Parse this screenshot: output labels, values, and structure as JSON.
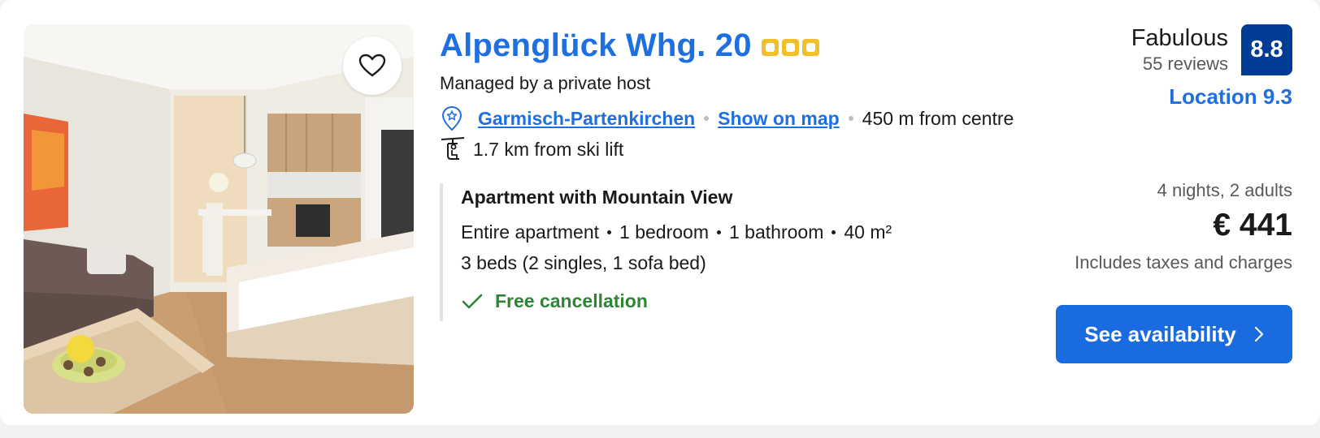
{
  "listing": {
    "title": "Alpenglück Whg. 20",
    "star_count": 3,
    "host_text": "Managed by a private host",
    "location": {
      "town": "Garmisch-Partenkirchen",
      "map_link": "Show on map",
      "distance_centre": "450 m from centre",
      "distance_ski_lift": "1.7 km from ski lift"
    },
    "room": {
      "name": "Apartment with Mountain View",
      "details": [
        "Entire apartment",
        "1 bedroom",
        "1 bathroom",
        "40 m²"
      ],
      "beds": "3 beds (2 singles, 1 sofa bed)",
      "cancellation": "Free cancellation"
    }
  },
  "review": {
    "label": "Fabulous",
    "count_text": "55 reviews",
    "score": "8.8",
    "location_score": "Location 9.3"
  },
  "pricing": {
    "stay_summary": "4 nights, 2 adults",
    "price": "€ 441",
    "tax_note": "Includes taxes and charges",
    "cta_label": "See availability"
  },
  "colors": {
    "link_blue": "#1e6fe0",
    "score_navy": "#003b95",
    "star_gold": "#f2bf2c",
    "success_green": "#2e8535",
    "cta_blue": "#1a6be0"
  },
  "icons": {
    "favorite": "heart-outline-icon",
    "location": "map-pin-star-icon",
    "ski_lift": "ski-lift-icon",
    "check": "checkmark-icon",
    "cta": "chevron-right-icon"
  }
}
